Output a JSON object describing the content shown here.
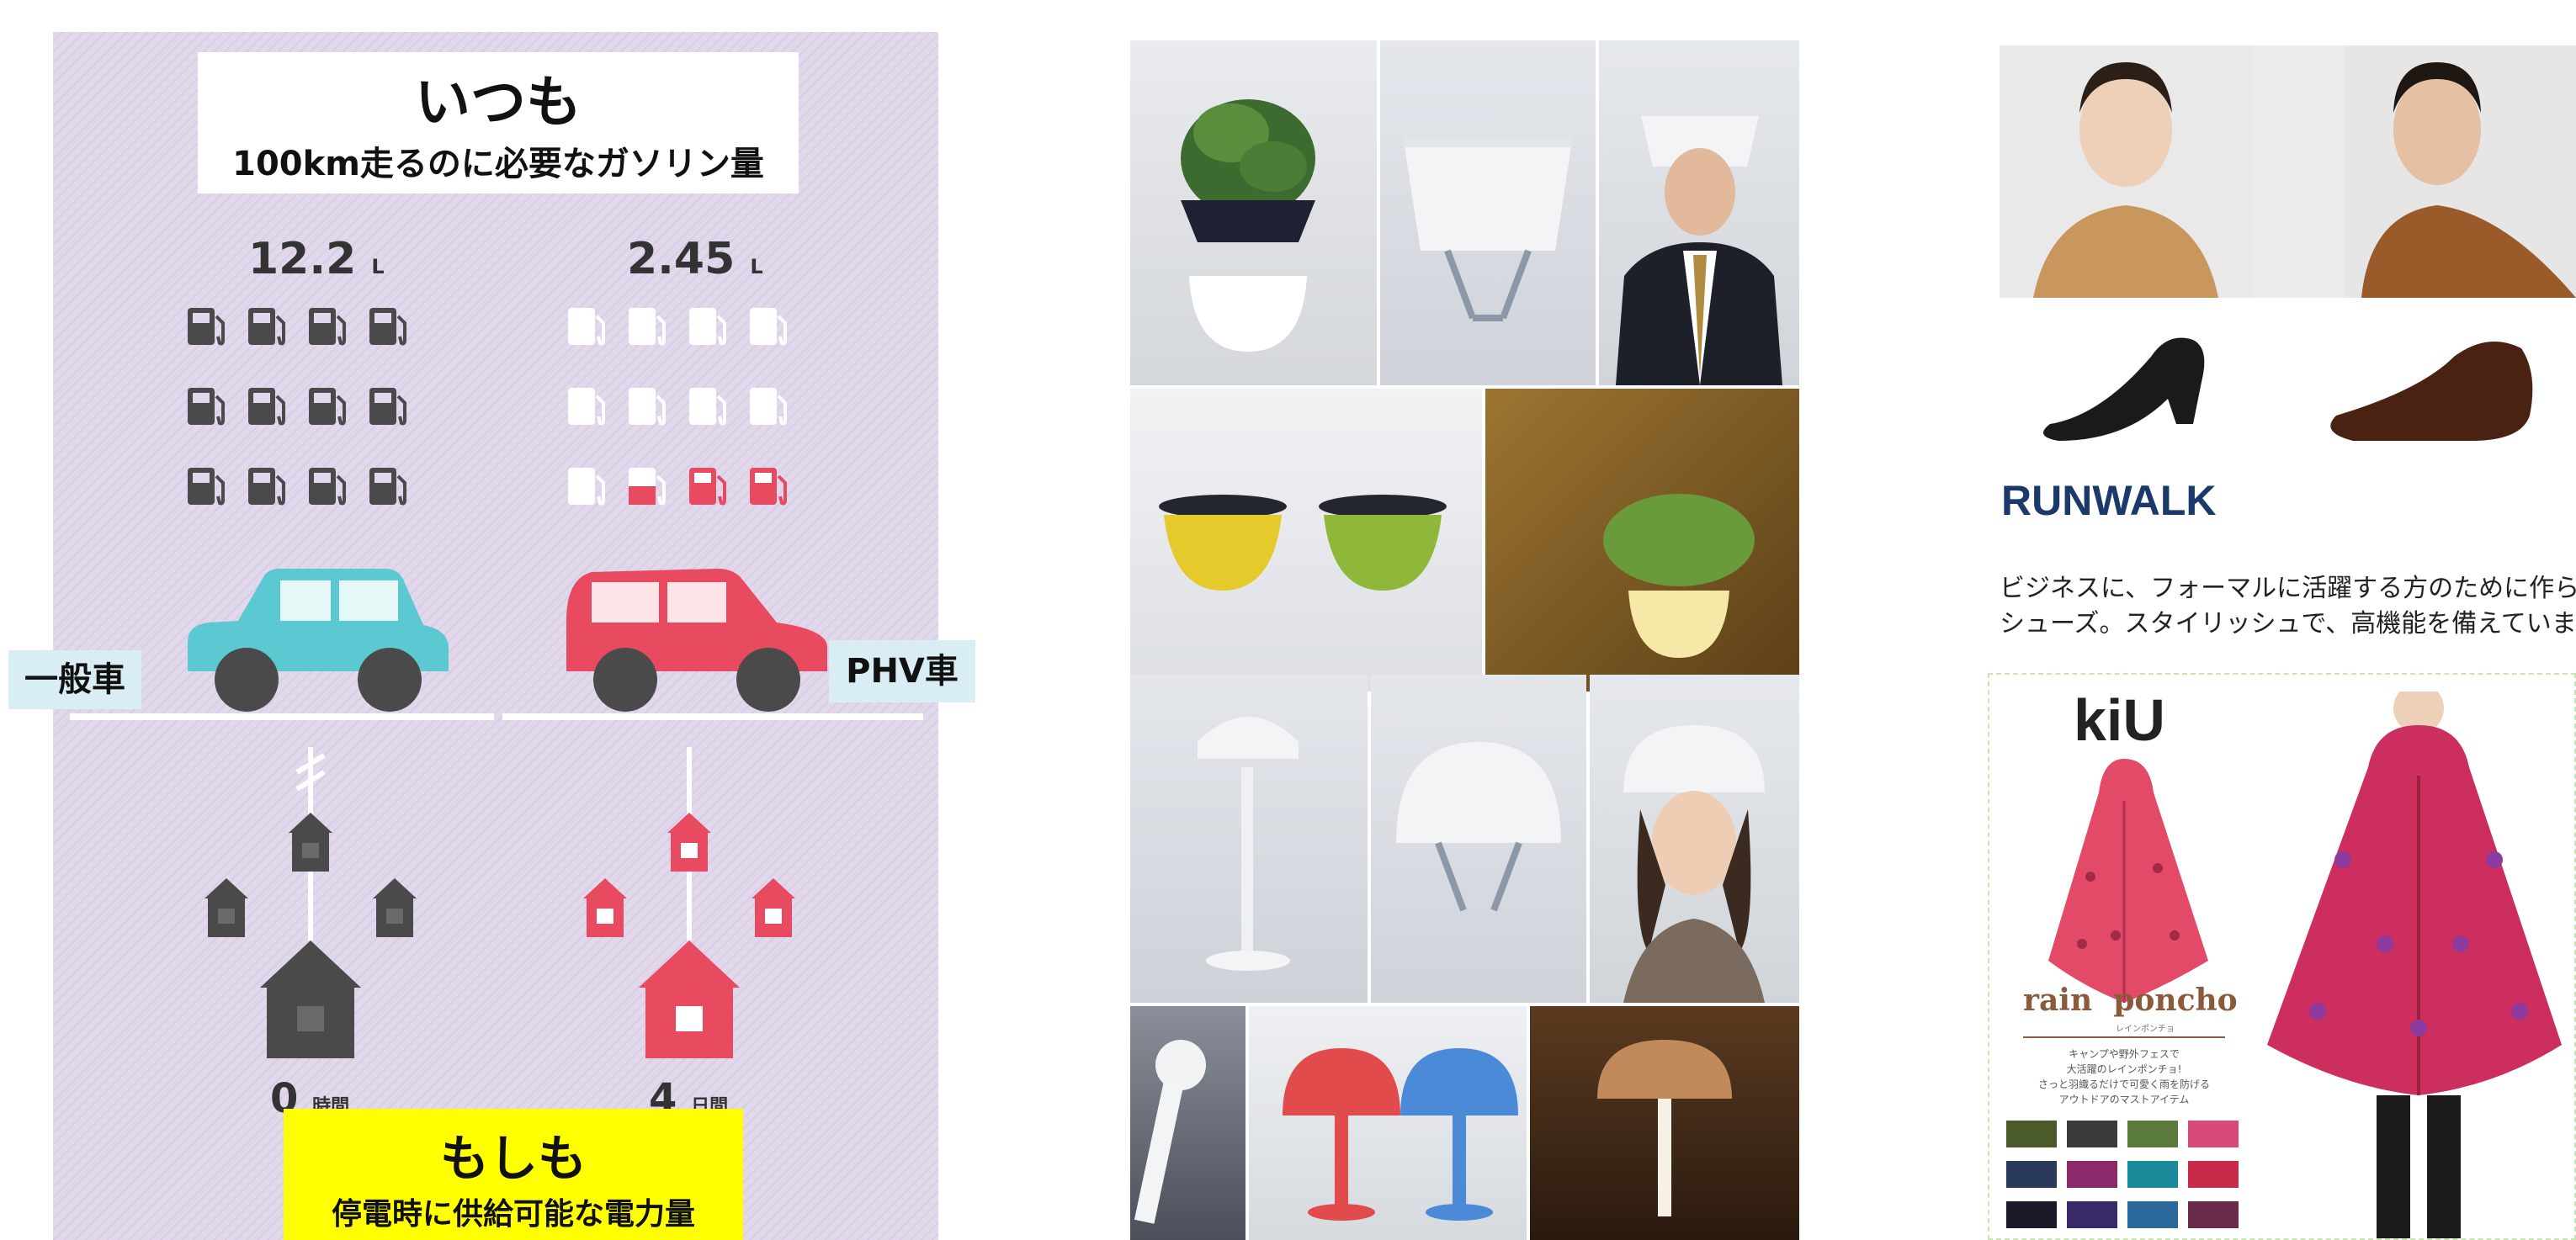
{
  "infographic": {
    "top_title": "いつも",
    "top_subtitle": "100km走るのに必要なガソリン量",
    "left_amount": "12.2",
    "left_unit": "L",
    "right_amount": "2.45",
    "right_unit": "L",
    "left_car_label": "一般車",
    "right_car_label": "PHV車",
    "left_days": "0",
    "left_days_unit": "時間",
    "right_days": "4",
    "right_days_unit": "日間",
    "bottom_title": "もしも",
    "bottom_subtitle": "停電時に供給可能な電力量",
    "colors": {
      "regular_car": "#5bc8d2",
      "phv_car": "#e84a5f",
      "dark": "#4a4a4a",
      "highlight": "#ffff00"
    }
  },
  "product_grid": {
    "tiles": [
      "plant-pot",
      "white-helmet",
      "man-with-helmet",
      "yellow-green-pots",
      "pot-on-desk",
      "helmet-lamp",
      "helmet-grey",
      "woman-with-helmet",
      "flashlight",
      "red-blue-lamps",
      "brown-lamp"
    ]
  },
  "runwalk": {
    "title": "RUNWALK",
    "desc_line1": "ビジネスに、フォーマルに活躍する方のために作られた",
    "desc_line2": "シューズ。スタイリッシュで、高機能を備えています。"
  },
  "kiu": {
    "logo": "kiU",
    "heading": "rain  poncho",
    "sub_small": "レインポンチョ",
    "text_line1": "キャンプや野外フェスで",
    "text_line2": "大活躍のレインポンチョ!",
    "text_line3": "さっと羽織るだけで可愛く雨を防げる",
    "text_line4": "アウトドアのマストアイテム"
  }
}
